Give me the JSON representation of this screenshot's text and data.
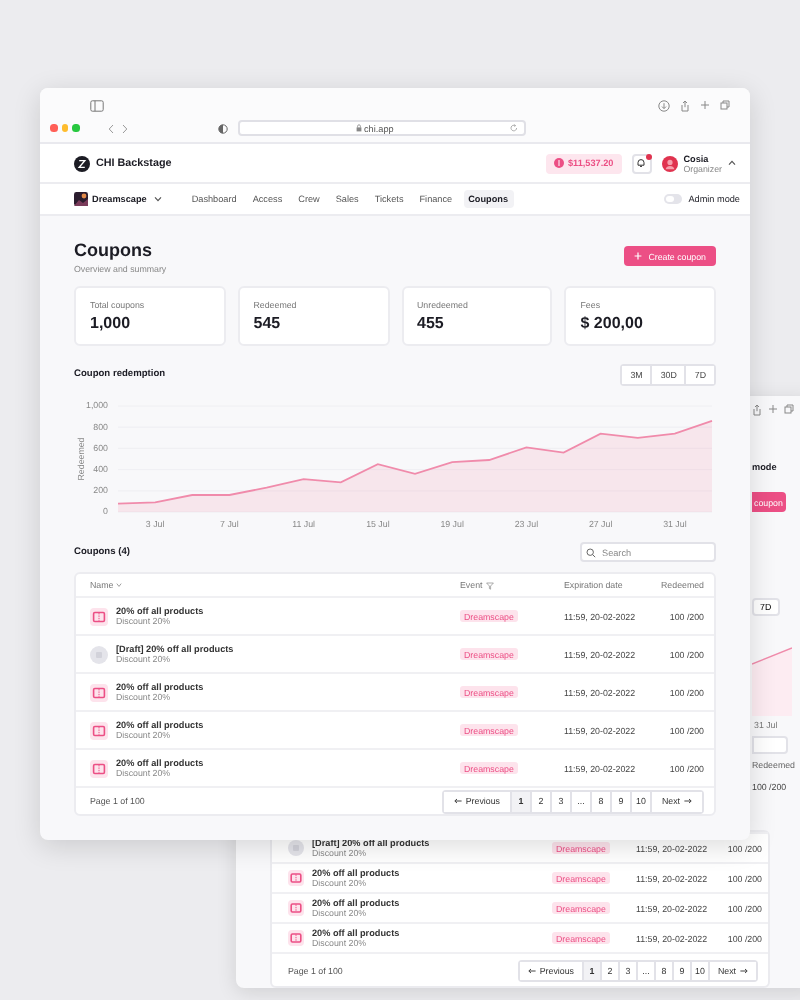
{
  "browser": {
    "url": "chi.app"
  },
  "app": {
    "name": "CHI Backstage",
    "balance": "$11,537.20",
    "notifications": {
      "unread": true
    },
    "user": {
      "name": "Cosia",
      "role": "Organizer"
    }
  },
  "nav": {
    "event": "Dreamscape",
    "items": [
      {
        "label": "Dashboard",
        "selected": false
      },
      {
        "label": "Access",
        "selected": false
      },
      {
        "label": "Crew",
        "selected": false
      },
      {
        "label": "Sales",
        "selected": false
      },
      {
        "label": "Tickets",
        "selected": false
      },
      {
        "label": "Finance",
        "selected": false
      },
      {
        "label": "Coupons",
        "selected": true
      }
    ],
    "admin_mode": {
      "label": "Admin mode",
      "on": false
    }
  },
  "page": {
    "title": "Coupons",
    "subtitle": "Overview and summary",
    "create_button": "Create coupon"
  },
  "stats": [
    {
      "label": "Total coupons",
      "value": "1,000"
    },
    {
      "label": "Redeemed",
      "value": "545"
    },
    {
      "label": "Unredeemed",
      "value": "455"
    },
    {
      "label": "Fees",
      "value": "$ 200,00"
    }
  ],
  "redemption": {
    "title": "Coupon redemption",
    "ranges": [
      {
        "label": "3M",
        "selected": false
      },
      {
        "label": "30D",
        "selected": false
      },
      {
        "label": "7D",
        "selected": false
      }
    ],
    "chart_data": {
      "type": "area",
      "categories": [
        null,
        "3 Jul",
        null,
        "7 Jul",
        null,
        "11 Jul",
        null,
        "15 Jul",
        null,
        "19 Jul",
        null,
        "23 Jul",
        null,
        "27 Jul",
        null,
        "31 Jul",
        null
      ],
      "series": [
        {
          "name": "Redeemed",
          "color": "#f08bab",
          "values": [
            80,
            90,
            160,
            160,
            230,
            310,
            280,
            450,
            360,
            470,
            490,
            610,
            560,
            740,
            700,
            740,
            860
          ]
        }
      ],
      "ylim": [
        0,
        1000
      ],
      "grid": true,
      "yticks": [
        0,
        200,
        400,
        600,
        800,
        {
          "value": 1000,
          "label": "1,000"
        }
      ]
    }
  },
  "coupons": {
    "title": "Coupons (4)",
    "search": {
      "placeholder": "Search"
    },
    "columns": [
      "Name",
      "Event",
      "Expiration date",
      "Redeemed"
    ],
    "rows": [
      {
        "name": "20% off all products",
        "detail": "Discount 20%",
        "draft": false,
        "event": "Dreamscape",
        "expiration": "11:59, 20-02-2022",
        "redeemed": "100 /200"
      },
      {
        "name": "[Draft] 20% off all products",
        "detail": "Discount 20%",
        "draft": true,
        "event": "Dreamscape",
        "expiration": "11:59, 20-02-2022",
        "redeemed": "100 /200"
      },
      {
        "name": "20% off all products",
        "detail": "Discount 20%",
        "draft": false,
        "event": "Dreamscape",
        "expiration": "11:59, 20-02-2022",
        "redeemed": "100 /200"
      },
      {
        "name": "20% off all products",
        "detail": "Discount 20%",
        "draft": false,
        "event": "Dreamscape",
        "expiration": "11:59, 20-02-2022",
        "redeemed": "100 /200"
      },
      {
        "name": "20% off all products",
        "detail": "Discount 20%",
        "draft": false,
        "event": "Dreamscape",
        "expiration": "11:59, 20-02-2022",
        "redeemed": "100 /200"
      }
    ],
    "footer": "Page 1 of 100",
    "pagination": {
      "previous": "Previous",
      "next": "Next",
      "pages": [
        {
          "label": "1",
          "selected": true
        },
        {
          "label": "2",
          "selected": false
        },
        {
          "label": "3",
          "selected": false
        },
        {
          "label": "...",
          "selected": false
        },
        {
          "label": "8",
          "selected": false
        },
        {
          "label": "9",
          "selected": false
        },
        {
          "label": "10",
          "selected": false
        }
      ]
    }
  },
  "background_window": {
    "admin_mode": "mode",
    "create_button": "coupon",
    "range": "7D",
    "chart_label": "31 Jul",
    "column": "Redeemed",
    "first_redeemed": "100 /200",
    "rows": [
      {
        "name": "[Draft] 20% off all products",
        "detail": "Discount 20%",
        "draft": true,
        "event": "Dreamscape",
        "expiration": "11:59, 20-02-2022",
        "redeemed": "100 /200"
      },
      {
        "name": "20% off all products",
        "detail": "Discount 20%",
        "draft": false,
        "event": "Dreamscape",
        "expiration": "11:59, 20-02-2022",
        "redeemed": "100 /200"
      },
      {
        "name": "20% off all products",
        "detail": "Discount 20%",
        "draft": false,
        "event": "Dreamscape",
        "expiration": "11:59, 20-02-2022",
        "redeemed": "100 /200"
      },
      {
        "name": "20% off all products",
        "detail": "Discount 20%",
        "draft": false,
        "event": "Dreamscape",
        "expiration": "11:59, 20-02-2022",
        "redeemed": "100 /200"
      }
    ],
    "footer": "Page 1 of 100",
    "pagination": {
      "previous": "Previous",
      "next": "Next",
      "pages": [
        {
          "label": "1",
          "selected": true
        },
        {
          "label": "2",
          "selected": false
        },
        {
          "label": "3",
          "selected": false
        },
        {
          "label": "...",
          "selected": false
        },
        {
          "label": "8",
          "selected": false
        },
        {
          "label": "9",
          "selected": false
        },
        {
          "label": "10",
          "selected": false
        }
      ]
    }
  }
}
